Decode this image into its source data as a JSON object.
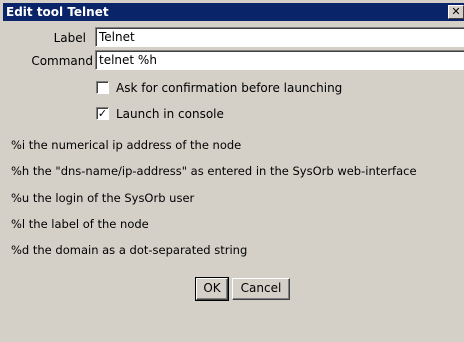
{
  "window": {
    "title": "Edit tool Telnet",
    "close_glyph": "✕"
  },
  "form": {
    "label_caption": "Label",
    "label_value": "Telnet",
    "command_caption": "Command",
    "command_value": "telnet %h"
  },
  "options": {
    "confirm_label": "Ask for confirmation before launching",
    "confirm_checked": false,
    "console_label": "Launch in console",
    "console_checked": true
  },
  "help": [
    "%i the numerical ip address of the node",
    "%h the \"dns-name/ip-address\" as entered in the SysOrb web-interface",
    "%u the login of the SysOrb user",
    "%l the label of the node",
    "%d the domain as a dot-separated string"
  ],
  "buttons": {
    "ok": "OK",
    "cancel": "Cancel"
  },
  "colors": {
    "titlebar": "#0a246a",
    "window_bg": "#d4d0c8"
  }
}
